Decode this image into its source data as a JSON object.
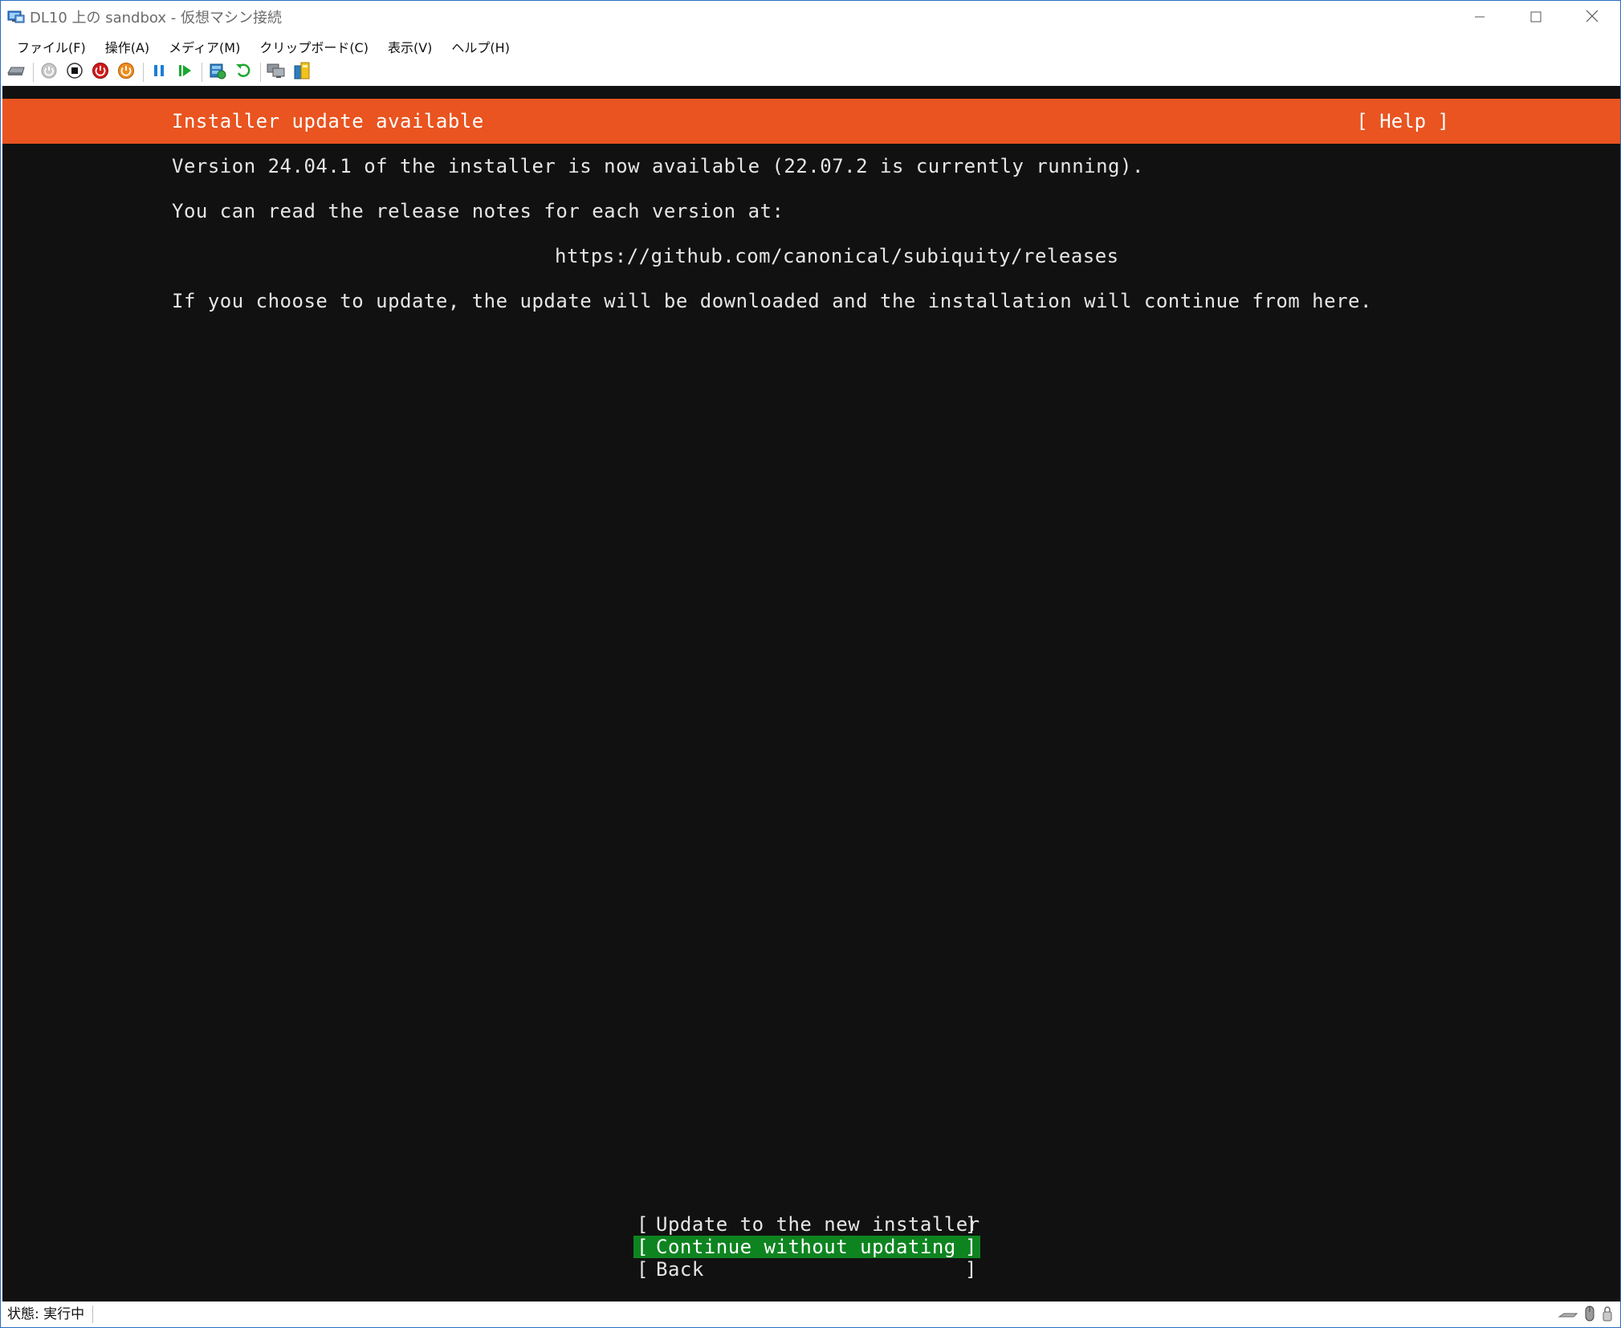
{
  "window": {
    "title": "DL10 上の sandbox - 仮想マシン接続",
    "minimize_icon": "minimize-icon",
    "maximize_icon": "maximize-icon",
    "close_icon": "close-icon"
  },
  "menubar": {
    "items": [
      "ファイル(F)",
      "操作(A)",
      "メディア(M)",
      "クリップボード(C)",
      "表示(V)",
      "ヘルプ(H)"
    ]
  },
  "toolbar": {
    "icons": [
      "ctrl-alt-del-icon",
      "start-icon",
      "turn-off-icon",
      "shutdown-icon",
      "save-icon",
      "pause-icon",
      "resume-icon",
      "checkpoint-icon",
      "revert-icon",
      "enhanced-session-icon",
      "share-icon"
    ]
  },
  "installer": {
    "header_title": "Installer update available",
    "help_label": "[ Help ]",
    "line1": "Version 24.04.1 of the installer is now available (22.07.2 is currently running).",
    "line2": "You can read the release notes for each version at:",
    "url": "https://github.com/canonical/subiquity/releases",
    "line3": "If you choose to update, the update will be downloaded and the installation will continue from here.",
    "buttons": [
      {
        "label": "Update to the new installer",
        "selected": false
      },
      {
        "label": "Continue without updating",
        "selected": true
      },
      {
        "label": "Back",
        "selected": false
      }
    ],
    "colors": {
      "header_bg": "#e95420",
      "console_bg": "#111111",
      "selected_bg": "#0e8420"
    }
  },
  "statusbar": {
    "status": "状態: 実行中",
    "icons": [
      "keyboard-icon",
      "mouse-icon",
      "lock-icon"
    ]
  }
}
